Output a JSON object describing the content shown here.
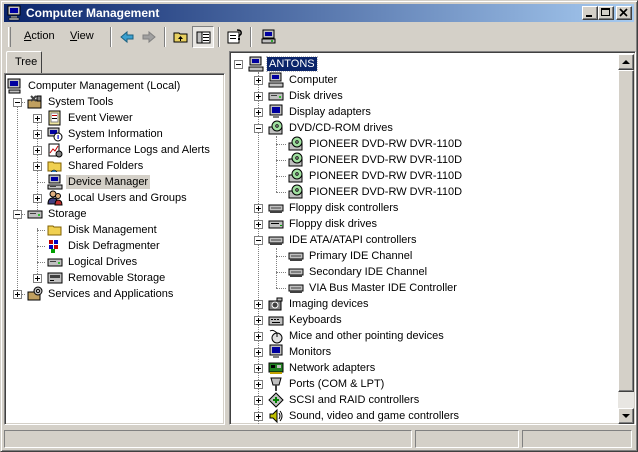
{
  "window": {
    "title": "Computer Management"
  },
  "menu": {
    "action": "Action",
    "action_key": "A",
    "view": "View",
    "view_key": "V"
  },
  "left_tab": {
    "label": "Tree"
  },
  "left_tree": [
    {
      "label": "Computer Management (Local)",
      "icon": "computer-management-icon"
    },
    {
      "label": "System Tools",
      "icon": "system-tools-icon"
    },
    {
      "label": "Event Viewer",
      "icon": "event-viewer-icon"
    },
    {
      "label": "System Information",
      "icon": "system-information-icon"
    },
    {
      "label": "Performance Logs and Alerts",
      "icon": "performance-logs-icon"
    },
    {
      "label": "Shared Folders",
      "icon": "folder-icon"
    },
    {
      "label": "Device Manager",
      "icon": "device-manager-icon"
    },
    {
      "label": "Local Users and Groups",
      "icon": "users-icon"
    },
    {
      "label": "Storage",
      "icon": "storage-icon"
    },
    {
      "label": "Disk Management",
      "icon": "folder-icon"
    },
    {
      "label": "Disk Defragmenter",
      "icon": "defragmenter-icon"
    },
    {
      "label": "Logical Drives",
      "icon": "drive-icon"
    },
    {
      "label": "Removable Storage",
      "icon": "removable-storage-icon"
    },
    {
      "label": "Services and Applications",
      "icon": "services-icon"
    }
  ],
  "device_tree": [
    {
      "label": "ANTONS",
      "icon": "computer-icon"
    },
    {
      "label": "Computer",
      "icon": "computer-icon"
    },
    {
      "label": "Disk drives",
      "icon": "disk-drive-icon"
    },
    {
      "label": "Display adapters",
      "icon": "monitor-icon"
    },
    {
      "label": "DVD/CD-ROM drives",
      "icon": "cdrom-icon"
    },
    {
      "label": "PIONEER DVD-RW  DVR-110D",
      "icon": "cdrom-icon"
    },
    {
      "label": "PIONEER DVD-RW  DVR-110D",
      "icon": "cdrom-icon"
    },
    {
      "label": "PIONEER DVD-RW  DVR-110D",
      "icon": "cdrom-icon"
    },
    {
      "label": "PIONEER DVD-RW  DVR-110D",
      "icon": "cdrom-icon"
    },
    {
      "label": "Floppy disk controllers",
      "icon": "controller-icon"
    },
    {
      "label": "Floppy disk drives",
      "icon": "floppy-icon"
    },
    {
      "label": "IDE ATA/ATAPI controllers",
      "icon": "controller-icon"
    },
    {
      "label": "Primary IDE Channel",
      "icon": "controller-icon"
    },
    {
      "label": "Secondary IDE Channel",
      "icon": "controller-icon"
    },
    {
      "label": "VIA Bus Master IDE Controller",
      "icon": "controller-icon"
    },
    {
      "label": "Imaging devices",
      "icon": "camera-icon"
    },
    {
      "label": "Keyboards",
      "icon": "keyboard-icon"
    },
    {
      "label": "Mice and other pointing devices",
      "icon": "mouse-icon"
    },
    {
      "label": "Monitors",
      "icon": "monitor-icon"
    },
    {
      "label": "Network adapters",
      "icon": "network-adapter-icon"
    },
    {
      "label": "Ports (COM & LPT)",
      "icon": "port-icon"
    },
    {
      "label": "SCSI and RAID controllers",
      "icon": "scsi-icon"
    },
    {
      "label": "Sound, video and game controllers",
      "icon": "sound-icon"
    }
  ],
  "colors": {
    "title_start": "#0a246a",
    "title_end": "#a6caf0",
    "selection": "#0a246a"
  }
}
